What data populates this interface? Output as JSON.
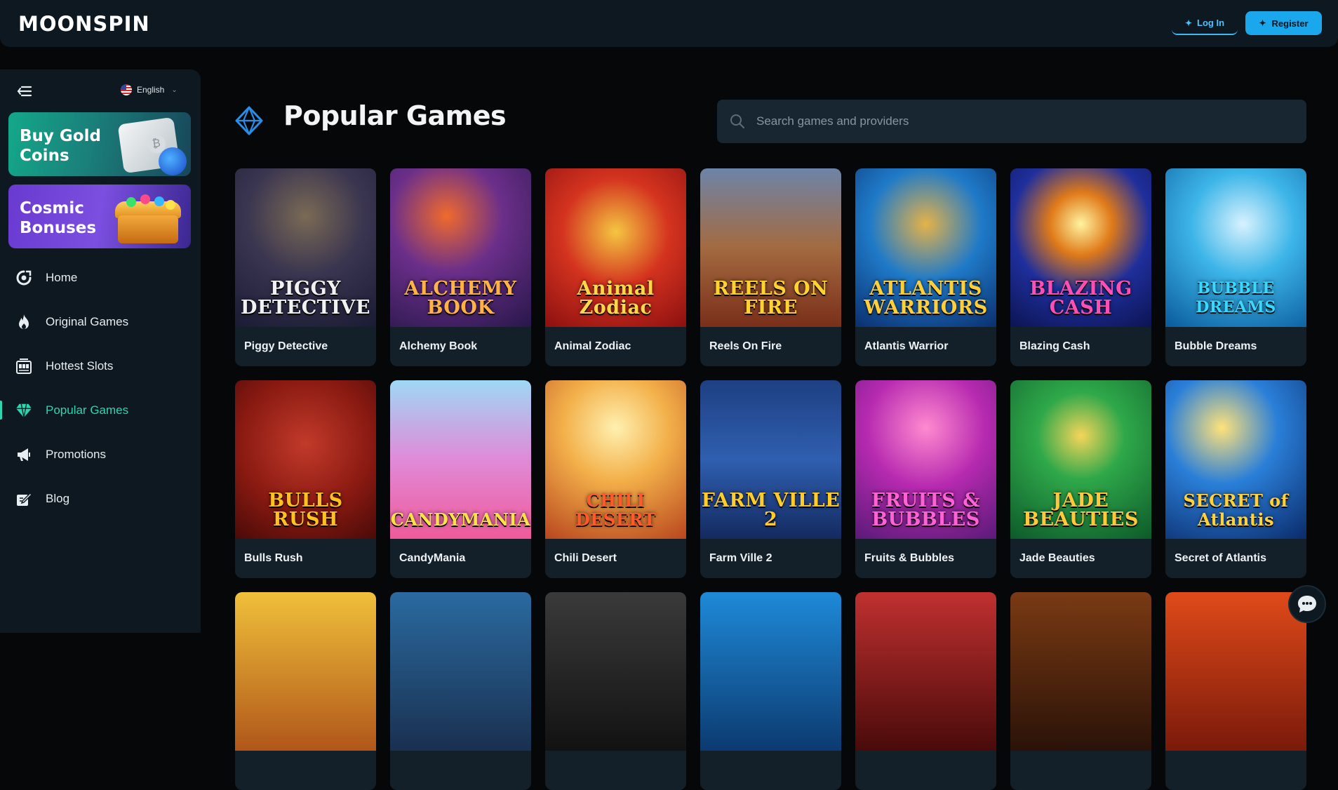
{
  "header": {
    "logo": "MOONSPIN",
    "login_label": "Log In",
    "register_label": "Register"
  },
  "sidebar": {
    "language": "English",
    "promos": [
      {
        "label": "Buy Gold Coins"
      },
      {
        "label": "Cosmic Bonuses"
      }
    ],
    "items": [
      {
        "label": "Home",
        "icon": "home-icon"
      },
      {
        "label": "Original Games",
        "icon": "flame-icon"
      },
      {
        "label": "Hottest Slots",
        "icon": "slot-machine-icon"
      },
      {
        "label": "Popular Games",
        "icon": "diamond-icon",
        "active": true
      },
      {
        "label": "Promotions",
        "icon": "megaphone-icon"
      },
      {
        "label": "Blog",
        "icon": "edit-icon"
      }
    ]
  },
  "main": {
    "title": "Popular Games",
    "search_placeholder": "Search games and providers",
    "games": [
      {
        "title": "Piggy Detective",
        "logo": "PIGGY DETECTIVE"
      },
      {
        "title": "Alchemy Book",
        "logo": "ALCHEMY BOOK"
      },
      {
        "title": "Animal Zodiac",
        "logo": "Animal Zodiac"
      },
      {
        "title": "Reels On Fire",
        "logo": "REELS ON FIRE"
      },
      {
        "title": "Atlantis Warrior",
        "logo": "ATLANTIS WARRIORS"
      },
      {
        "title": "Blazing Cash",
        "logo": "BLAZING CASH"
      },
      {
        "title": "Bubble Dreams",
        "logo": "BUBBLE DREAMS"
      },
      {
        "title": "Bulls Rush",
        "logo": "BULLS RUSH"
      },
      {
        "title": "CandyMania",
        "logo": "CANDYMANIA"
      },
      {
        "title": "Chili Desert",
        "logo": "CHILI DESERT"
      },
      {
        "title": "Farm Ville 2",
        "logo": "FARM VILLE 2"
      },
      {
        "title": "Fruits & Bubbles",
        "logo": "FRUITS & BUBBLES"
      },
      {
        "title": "Jade Beauties",
        "logo": "JADE BEAUTIES"
      },
      {
        "title": "Secret of Atlantis",
        "logo": "SECRET of Atlantis"
      }
    ]
  },
  "colors": {
    "accent": "#2bd6b0",
    "register": "#1aa7ec",
    "panel": "#0d1820",
    "background": "#060709"
  }
}
